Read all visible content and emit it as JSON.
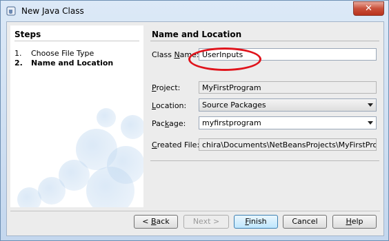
{
  "window": {
    "title": "New Java Class",
    "close_label": "✕"
  },
  "steps": {
    "title": "Steps",
    "items": [
      {
        "num": "1.",
        "label": "Choose File Type",
        "current": false
      },
      {
        "num": "2.",
        "label": "Name and Location",
        "current": true
      }
    ]
  },
  "panel": {
    "title": "Name and Location",
    "class_name": {
      "label_pre": "Class ",
      "label_mn": "N",
      "label_post": "ame:",
      "value": "UserInputs"
    },
    "project": {
      "label_mn": "P",
      "label_post": "roject:",
      "value": "MyFirstProgram"
    },
    "location": {
      "label_mn": "L",
      "label_post": "ocation:",
      "value": "Source Packages"
    },
    "package": {
      "label_pre": "Pac",
      "label_mn": "k",
      "label_post": "age:",
      "value": "myfirstprogram"
    },
    "created_file": {
      "label_mn": "C",
      "label_post": "reated File:",
      "value": "chira\\Documents\\NetBeansProjects\\MyFirstProgram\\src\\myfirstprogram\\UserInputs.java"
    }
  },
  "buttons": {
    "back": {
      "pre": "< ",
      "mn": "B",
      "post": "ack"
    },
    "next": "Next >",
    "finish": {
      "mn": "F",
      "post": "inish"
    },
    "cancel": "Cancel",
    "help": {
      "mn": "H",
      "post": "elp"
    }
  },
  "colors": {
    "annotation": "#e0141c",
    "title_bar": "#c4d7ee",
    "close_button": "#c9503a"
  }
}
